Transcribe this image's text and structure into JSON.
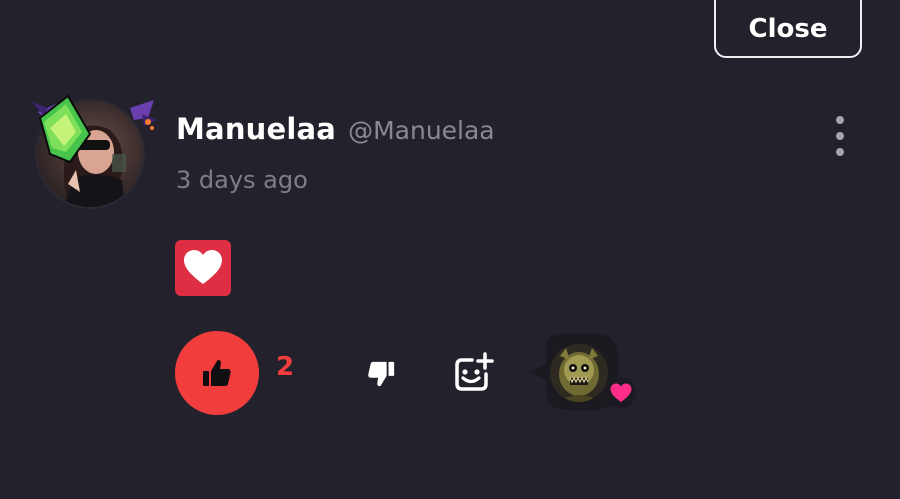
{
  "header": {
    "close_label": "Close"
  },
  "comment": {
    "author_name": "Manuelaa",
    "author_handle": "@Manuelaa",
    "timestamp": "3 days ago",
    "content_emoji": "heart",
    "likes_count": "2"
  },
  "icons": {
    "more": "more-vertical-icon",
    "like": "thumbs-up-icon",
    "dislike": "thumbs-down-icon",
    "add_reaction": "add-reaction-icon",
    "reaction": "heart-icon"
  },
  "colors": {
    "background": "#23222c",
    "accent": "#f23d3d",
    "heart_tile": "#dd2e44",
    "reaction_heart": "#ff2d8a",
    "muted_text": "#8a8993"
  }
}
